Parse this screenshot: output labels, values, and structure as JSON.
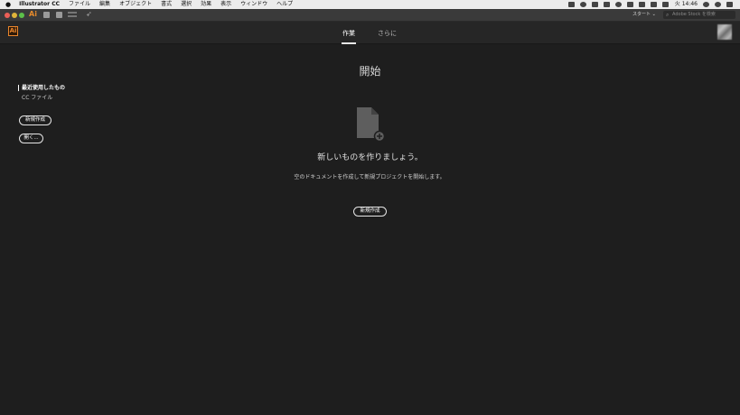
{
  "menubar": {
    "app_name": "Illustrator CC",
    "items": [
      "ファイル",
      "編集",
      "オブジェクト",
      "書式",
      "選択",
      "効果",
      "表示",
      "ウィンドウ",
      "ヘルプ"
    ],
    "clock": "火 14:46"
  },
  "toolbar": {
    "app_icon": "Ai",
    "start_dropdown": "スタート ⌄",
    "search_placeholder": "Adobe Stock を検索"
  },
  "header": {
    "logo": "Ai",
    "tabs": [
      {
        "label": "作業",
        "active": true
      },
      {
        "label": "さらに",
        "active": false
      }
    ]
  },
  "main": {
    "title": "開始",
    "sidebar": {
      "recent_label": "最近使用したもの",
      "cc_files": "CC ファイル",
      "new_button": "新規作成",
      "open_button": "開く..."
    },
    "empty_state": {
      "heading": "新しいものを作りましょう。",
      "description": "空のドキュメントを作成して新規プロジェクトを開始します。",
      "new_button": "新規作成"
    }
  },
  "colors": {
    "background": "#1e1e1e",
    "accent": "#e8852c"
  }
}
